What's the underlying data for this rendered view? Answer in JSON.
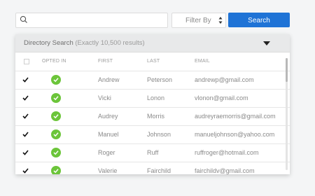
{
  "search": {
    "placeholder": "",
    "value": ""
  },
  "filter": {
    "label": "Filter By"
  },
  "search_button": {
    "label": "Search"
  },
  "panel": {
    "title": "Directory Search",
    "count_note": "(Exactly 10,500 results)"
  },
  "columns": {
    "opted_in": "OPTED IN",
    "first": "FIRST",
    "last": "LAST",
    "email": "EMAIL"
  },
  "rows": [
    {
      "first": "Andrew",
      "last": "Peterson",
      "email": "andrewp@gmail.com",
      "selected": true,
      "opted_in": true
    },
    {
      "first": "Vicki",
      "last": "Lonon",
      "email": "vlonon@gmail.com",
      "selected": true,
      "opted_in": true
    },
    {
      "first": "Audrey",
      "last": "Morris",
      "email": "audreyraemorris@gmail.com",
      "selected": true,
      "opted_in": true
    },
    {
      "first": "Manuel",
      "last": "Johnson",
      "email": "manueljohnson@yahoo.com",
      "selected": true,
      "opted_in": true
    },
    {
      "first": "Roger",
      "last": "Ruff",
      "email": "ruffroger@hotmail.com",
      "selected": true,
      "opted_in": true
    },
    {
      "first": "Valerie",
      "last": "Fairchild",
      "email": "fairchildv@gmail.com",
      "selected": true,
      "opted_in": true
    }
  ],
  "colors": {
    "accent": "#1f73d6",
    "ok": "#6cc53a",
    "header_bg": "#e8e9ea"
  },
  "icons": {
    "search": "search-icon",
    "sort": "sort-arrows-icon",
    "toggle": "caret-down-icon",
    "check": "checkmark-icon",
    "opted": "check-circle-icon"
  }
}
